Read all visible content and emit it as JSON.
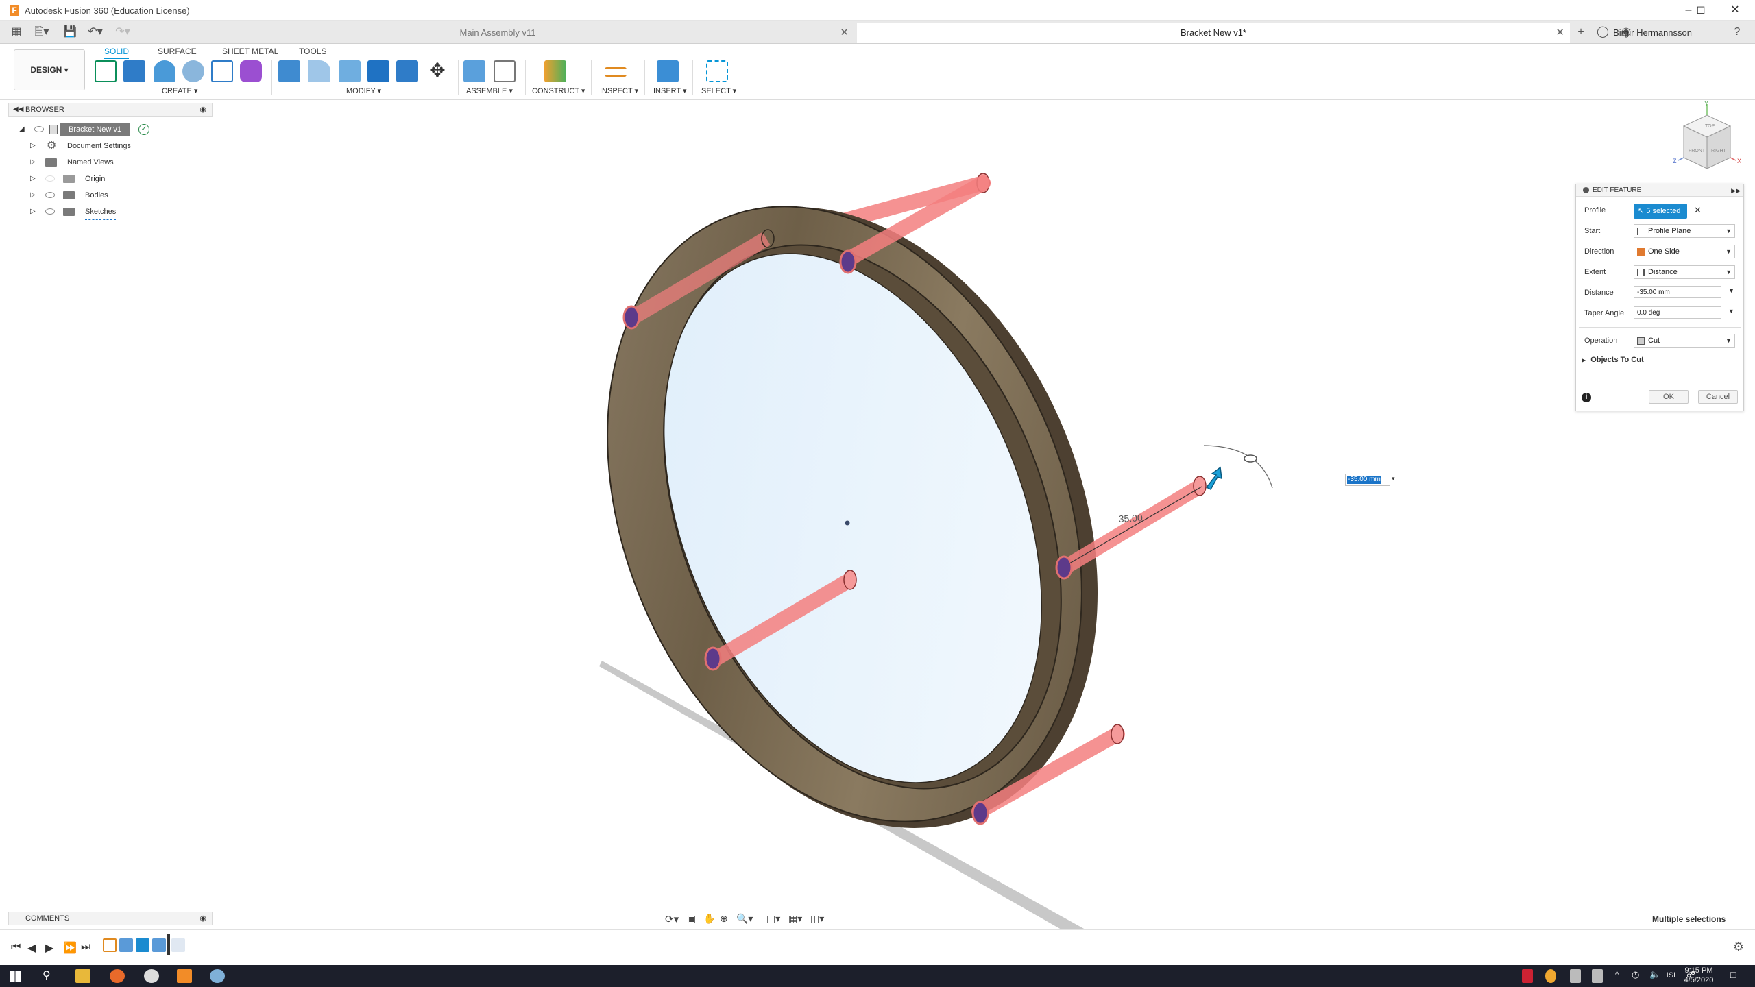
{
  "window": {
    "title": "Autodesk Fusion 360 (Education License)"
  },
  "tabs": [
    {
      "label": "Main Assembly v11",
      "active": false
    },
    {
      "label": "Bracket New v1*",
      "active": true
    }
  ],
  "user": {
    "name": "Birgir Hermannsson"
  },
  "toolbar": {
    "workspace": "DESIGN",
    "workspace_tabs": [
      "SOLID",
      "SURFACE",
      "SHEET METAL",
      "TOOLS"
    ],
    "groups": [
      "CREATE",
      "MODIFY",
      "ASSEMBLE",
      "CONSTRUCT",
      "INSPECT",
      "INSERT",
      "SELECT"
    ]
  },
  "browser": {
    "title": "BROWSER",
    "items": [
      {
        "label": "Bracket New v1"
      },
      {
        "label": "Document Settings"
      },
      {
        "label": "Named Views"
      },
      {
        "label": "Origin"
      },
      {
        "label": "Bodies"
      },
      {
        "label": "Sketches"
      }
    ]
  },
  "comments": {
    "title": "COMMENTS"
  },
  "edit_feature": {
    "title": "EDIT FEATURE",
    "profile_label": "Profile",
    "profile_value": "5 selected",
    "start_label": "Start",
    "start_value": "Profile Plane",
    "direction_label": "Direction",
    "direction_value": "One Side",
    "extent_label": "Extent",
    "extent_value": "Distance",
    "distance_label": "Distance",
    "distance_value": "-35.00 mm",
    "taper_label": "Taper Angle",
    "taper_value": "0.0 deg",
    "operation_label": "Operation",
    "operation_value": "Cut",
    "objects_to_cut": "Objects To Cut",
    "ok": "OK",
    "cancel": "Cancel"
  },
  "viewport": {
    "dimension_label": "35.00",
    "dimension_input": "-35.00 mm"
  },
  "viewcube": {
    "faces": [
      "TOP",
      "FRONT",
      "RIGHT"
    ],
    "axes": [
      "Y",
      "Z",
      "X"
    ]
  },
  "status": {
    "text": "Multiple selections"
  },
  "clock": {
    "time": "9:15 PM",
    "date": "4/5/2020"
  },
  "tray": {
    "language": "ISL"
  },
  "colors": {
    "accent": "#0696d7",
    "wood": "#7a6a52",
    "cut_preview": "#f07a7a"
  }
}
